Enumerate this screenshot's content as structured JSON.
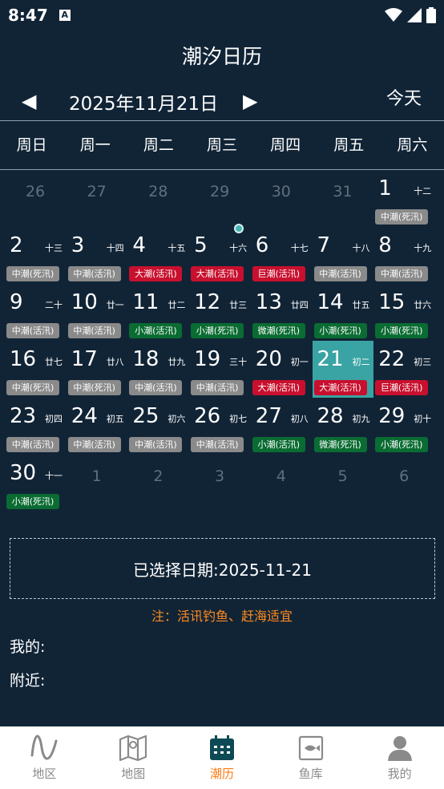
{
  "status": {
    "time": "8:47",
    "notif": "A"
  },
  "header": {
    "title": "潮汐日历"
  },
  "datebar": {
    "prev": "◀",
    "next": "▶",
    "date": "2025年11月21日",
    "today": "今天"
  },
  "weekdays": [
    "周日",
    "周一",
    "周二",
    "周三",
    "周四",
    "周五",
    "周六"
  ],
  "colors": {
    "gray": "#8a8a8a",
    "red": "#c8102e",
    "green": "#0a6c32",
    "selected": "#3aa3a3"
  },
  "calendar": [
    {
      "day": "26",
      "other": true
    },
    {
      "day": "27",
      "other": true
    },
    {
      "day": "28",
      "other": true
    },
    {
      "day": "29",
      "other": true
    },
    {
      "day": "30",
      "other": true
    },
    {
      "day": "31",
      "other": true
    },
    {
      "day": "1",
      "lunar": "十二",
      "tide": "中潮(死汛)",
      "color": "gray"
    },
    {
      "day": "2",
      "lunar": "十三",
      "tide": "中潮(死汛)",
      "color": "gray"
    },
    {
      "day": "3",
      "lunar": "十四",
      "tide": "中潮(活汛)",
      "color": "gray"
    },
    {
      "day": "4",
      "lunar": "十五",
      "tide": "大潮(活汛)",
      "color": "red"
    },
    {
      "day": "5",
      "lunar": "十六",
      "tide": "大潮(活汛)",
      "color": "red",
      "dot": true
    },
    {
      "day": "6",
      "lunar": "十七",
      "tide": "巨潮(活汛)",
      "color": "red"
    },
    {
      "day": "7",
      "lunar": "十八",
      "tide": "中潮(活汛)",
      "color": "gray"
    },
    {
      "day": "8",
      "lunar": "十九",
      "tide": "中潮(活汛)",
      "color": "gray"
    },
    {
      "day": "9",
      "lunar": "二十",
      "tide": "中潮(活汛)",
      "color": "gray"
    },
    {
      "day": "10",
      "lunar": "廿一",
      "tide": "中潮(活汛)",
      "color": "gray"
    },
    {
      "day": "11",
      "lunar": "廿二",
      "tide": "小潮(活汛)",
      "color": "green"
    },
    {
      "day": "12",
      "lunar": "廿三",
      "tide": "小潮(死汛)",
      "color": "green"
    },
    {
      "day": "13",
      "lunar": "廿四",
      "tide": "微潮(死汛)",
      "color": "green"
    },
    {
      "day": "14",
      "lunar": "廿五",
      "tide": "小潮(死汛)",
      "color": "green"
    },
    {
      "day": "15",
      "lunar": "廿六",
      "tide": "小潮(死汛)",
      "color": "green"
    },
    {
      "day": "16",
      "lunar": "廿七",
      "tide": "中潮(死汛)",
      "color": "gray"
    },
    {
      "day": "17",
      "lunar": "廿八",
      "tide": "中潮(死汛)",
      "color": "gray"
    },
    {
      "day": "18",
      "lunar": "廿九",
      "tide": "中潮(活汛)",
      "color": "gray"
    },
    {
      "day": "19",
      "lunar": "三十",
      "tide": "中潮(活汛)",
      "color": "gray"
    },
    {
      "day": "20",
      "lunar": "初一",
      "tide": "大潮(活汛)",
      "color": "red"
    },
    {
      "day": "21",
      "lunar": "初二",
      "tide": "大潮(活汛)",
      "color": "red",
      "selected": true
    },
    {
      "day": "22",
      "lunar": "初三",
      "tide": "巨潮(活汛)",
      "color": "red"
    },
    {
      "day": "23",
      "lunar": "初四",
      "tide": "中潮(活汛)",
      "color": "gray"
    },
    {
      "day": "24",
      "lunar": "初五",
      "tide": "中潮(活汛)",
      "color": "gray"
    },
    {
      "day": "25",
      "lunar": "初六",
      "tide": "中潮(活汛)",
      "color": "gray"
    },
    {
      "day": "26",
      "lunar": "初七",
      "tide": "中潮(活汛)",
      "color": "gray"
    },
    {
      "day": "27",
      "lunar": "初八",
      "tide": "小潮(活汛)",
      "color": "green"
    },
    {
      "day": "28",
      "lunar": "初九",
      "tide": "微潮(死汛)",
      "color": "green"
    },
    {
      "day": "29",
      "lunar": "初十",
      "tide": "小潮(死汛)",
      "color": "green"
    },
    {
      "day": "30",
      "lunar": "十一",
      "tide": "小潮(死汛)",
      "color": "green"
    },
    {
      "day": "1",
      "other": true
    },
    {
      "day": "2",
      "other": true
    },
    {
      "day": "3",
      "other": true
    },
    {
      "day": "4",
      "other": true
    },
    {
      "day": "5",
      "other": true
    },
    {
      "day": "6",
      "other": true
    }
  ],
  "selected": {
    "text": "已选择日期:2025-11-21"
  },
  "note": "注：活讯钓鱼、赶海适宜",
  "sections": {
    "mine": "我的:",
    "near": "附近:"
  },
  "tabs": [
    {
      "label": "地区",
      "icon": "wave-icon"
    },
    {
      "label": "地图",
      "icon": "map-icon"
    },
    {
      "label": "潮历",
      "icon": "calendar-icon",
      "active": true
    },
    {
      "label": "鱼库",
      "icon": "fish-book-icon"
    },
    {
      "label": "我的",
      "icon": "user-icon"
    }
  ]
}
